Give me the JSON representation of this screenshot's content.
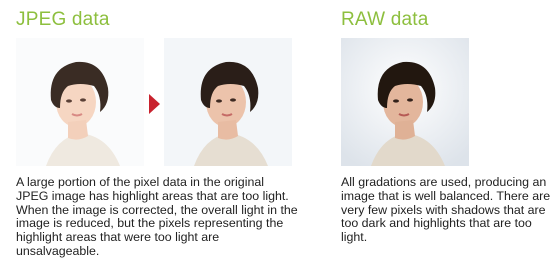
{
  "jpeg": {
    "title": "JPEG data",
    "caption": "A large portion of the pixel data in the original JPEG image has highlight areas that are too light. When the image is corrected, the overall light in the image is reduced, but the pixels representing the highlight areas that were too light are unsalvageable."
  },
  "raw": {
    "title": "RAW data",
    "caption": "All gradations are used, producing an image that is well balanced. There are very few pixels with shadows that are too dark and highlights that are too light."
  },
  "colors": {
    "title_green": "#8dbf3e",
    "arrow_red": "#c8222e"
  }
}
